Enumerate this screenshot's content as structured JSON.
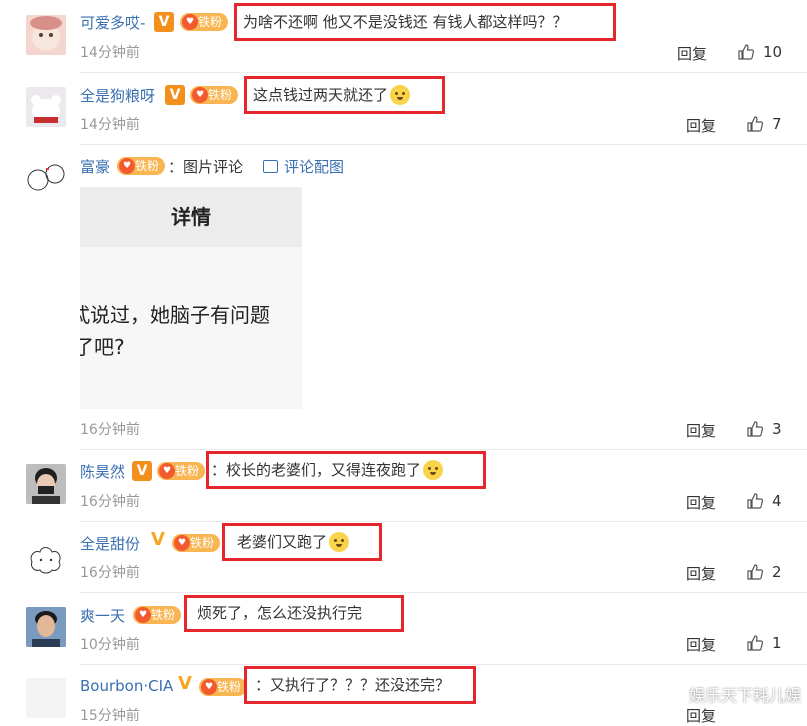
{
  "ui": {
    "reply_label": "回复"
  },
  "comments": [
    {
      "username": "可爱多哎-",
      "fan_level": "铁粉",
      "text": "为啥不还啊 他又不是没钱还 有钱人都这样吗？？",
      "time": "14分钟前",
      "likes": "10"
    },
    {
      "username": "全是狗粮呀",
      "fan_level": "铁粉",
      "text": "这点钱过两天就还了",
      "time": "14分钟前",
      "likes": "7"
    },
    {
      "username": "富豪",
      "fan_level": "铁粉",
      "text": "：图片评论",
      "pic_link": "评论配图",
      "image_title": "详情",
      "image_line1": "忒说过，她脑子有问题",
      "image_line2": "了吧?",
      "time": "16分钟前",
      "likes": "3"
    },
    {
      "username": "陈昊然",
      "fan_level": "铁粉",
      "text": "：校长的老婆们，又得连夜跑了",
      "time": "16分钟前",
      "likes": "4"
    },
    {
      "username": "全是甜份",
      "fan_level": "铁粉",
      "text": "老婆们又跑了",
      "time": "16分钟前",
      "likes": "2"
    },
    {
      "username": "爽一天",
      "fan_level": "铁粉",
      "text": "烦死了，怎么还没执行完",
      "time": "10分钟前",
      "likes": "1"
    },
    {
      "username": "Bourbon·CIA",
      "fan_level": "铁粉",
      "text": "：又执行了？？？还没还完？",
      "time": "15分钟前",
      "likes": ""
    }
  ],
  "watermark": "娱乐天下耗儿娱",
  "colors": {
    "highlight_border": "#e5262d",
    "link": "#3a6fb0",
    "fan_badge": "#f8b551"
  }
}
